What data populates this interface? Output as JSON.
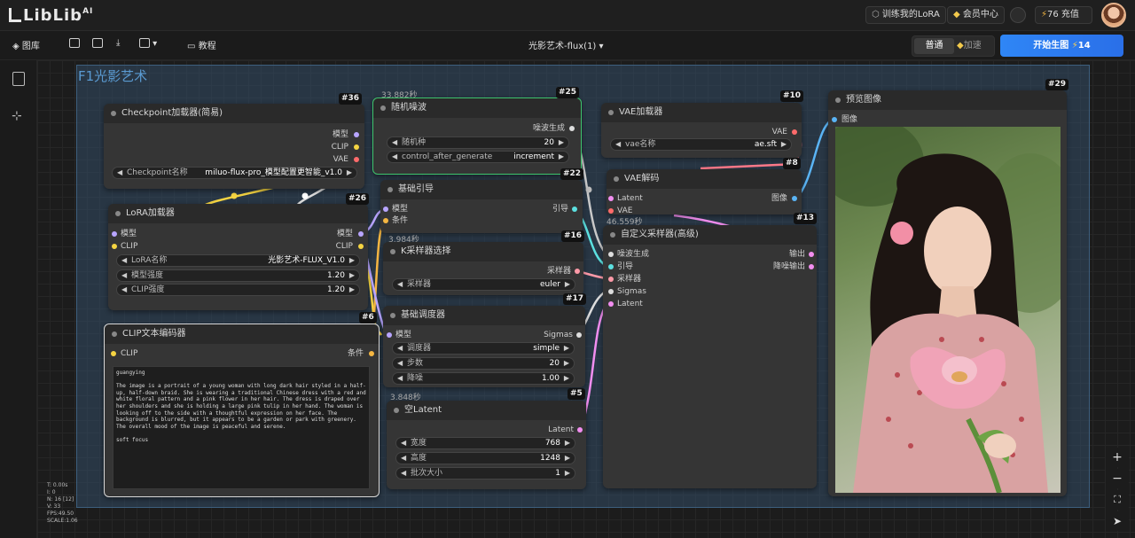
{
  "app": {
    "logo_text": "LibLib",
    "logo_sup": "AI"
  },
  "header": {
    "train_lora": "训练我的LoRA",
    "member_center": "会员中心",
    "credits": "76 充值"
  },
  "toolbar": {
    "library": "图库",
    "tutorial": "教程",
    "workflow_title": "光影艺术-flux(1)",
    "mode_normal": "普通",
    "mode_speed": "加速",
    "run_label": "开始生图",
    "run_cost": "14"
  },
  "group": {
    "title": "F1光影艺术"
  },
  "nodes": {
    "checkpoint": {
      "badge": "#36",
      "title": "Checkpoint加载器(简易)",
      "out_model": "模型",
      "out_clip": "CLIP",
      "out_vae": "VAE",
      "w_name": "Checkpoint名称",
      "w_value": "miluo-flux-pro_模型配置更智能_v1.0"
    },
    "lora": {
      "badge": "#26",
      "title": "LoRA加载器",
      "in_model": "模型",
      "in_clip": "CLIP",
      "out_model": "模型",
      "out_clip": "CLIP",
      "w1_name": "LoRA名称",
      "w1_value": "光影艺术-FLUX_V1.0",
      "w2_name": "模型强度",
      "w2_value": "1.20",
      "w3_name": "CLIP强度",
      "w3_value": "1.20"
    },
    "clip": {
      "badge": "#6",
      "title": "CLIP文本编码器",
      "in_clip": "CLIP",
      "out_cond": "条件",
      "text": "guangying\n\nThe image is a portrait of a young woman with long dark hair styled in a half-up, half-down braid. She is wearing a traditional Chinese dress with a red and white floral pattern and a pink flower in her hair. The dress is draped over her shoulders and she is holding a large pink tulip in her hand. The woman is looking off to the side with a thoughtful expression on her face. The background is blurred, but it appears to be a garden or park with greenery. The overall mood of the image is peaceful and serene.\n\nsoft focus"
    },
    "noise": {
      "badge": "#25",
      "timer": "33.882秒",
      "title": "随机噪波",
      "out": "噪波生成",
      "w1_name": "随机种",
      "w1_value": "20",
      "w2_name": "control_after_generate",
      "w2_value": "increment"
    },
    "guide": {
      "badge": "#22",
      "title": "基础引导",
      "in_model": "模型",
      "in_cond": "条件",
      "out": "引导"
    },
    "sampler": {
      "badge": "#16",
      "timer": "3.984秒",
      "title": "K采样器选择",
      "out": "采样器",
      "w_name": "采样器",
      "w_value": "euler"
    },
    "sched": {
      "badge": "#17",
      "title": "基础调度器",
      "in_model": "模型",
      "out": "Sigmas",
      "w1_name": "调度器",
      "w1_value": "simple",
      "w2_name": "步数",
      "w2_value": "20",
      "w3_name": "降噪",
      "w3_value": "1.00"
    },
    "latent": {
      "badge": "#5",
      "timer": "3.848秒",
      "title": "空Latent",
      "out": "Latent",
      "w1_name": "宽度",
      "w1_value": "768",
      "w2_name": "高度",
      "w2_value": "1248",
      "w3_name": "批次大小",
      "w3_value": "1"
    },
    "vae_loader": {
      "badge": "#10",
      "title": "VAE加载器",
      "out": "VAE",
      "w_name": "vae名称",
      "w_value": "ae.sft"
    },
    "vae_decode": {
      "badge": "#8",
      "title": "VAE解码",
      "in_latent": "Latent",
      "in_vae": "VAE",
      "out": "图像"
    },
    "adv_sampler": {
      "badge": "#13",
      "timer": "46.559秒",
      "title": "自定义采样器(高级)",
      "in1": "噪波生成",
      "in2": "引导",
      "in3": "采样器",
      "in4": "Sigmas",
      "in5": "Latent",
      "out1": "输出",
      "out2": "降噪输出"
    },
    "preview": {
      "badge": "#29",
      "title": "预览图像",
      "in": "图像"
    }
  },
  "stats": "T: 0.00s\nI: 0\nN: 16 [12]\nV: 33\nFPS:49.50\nSCALE:1.06",
  "colors": {
    "accent": "#2f86f6",
    "group_title": "#5a9ad1",
    "noise_border": "#3ec46d"
  }
}
